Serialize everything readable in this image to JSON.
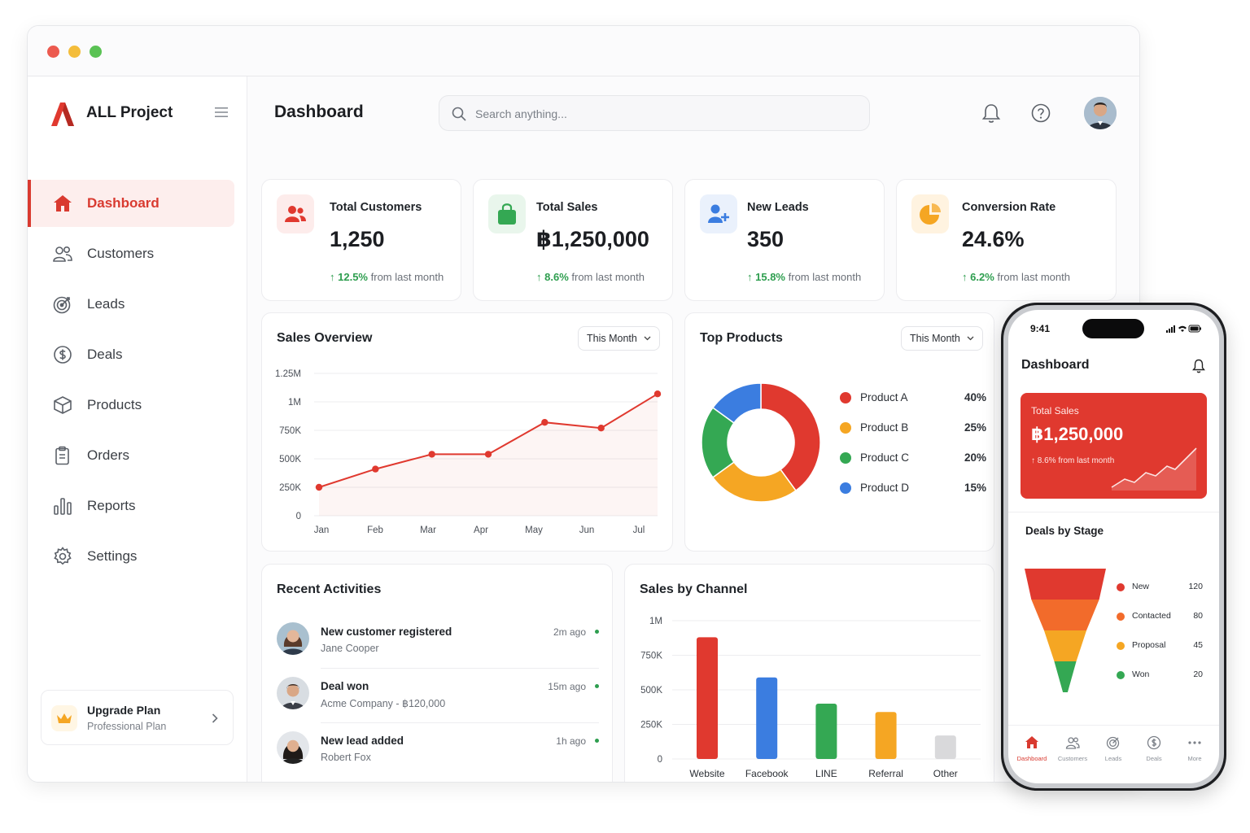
{
  "app": {
    "name": "ALL Project"
  },
  "sidebar": {
    "items": [
      {
        "label": "Dashboard",
        "icon": "home-icon",
        "active": true
      },
      {
        "label": "Customers",
        "icon": "users-icon"
      },
      {
        "label": "Leads",
        "icon": "target-icon"
      },
      {
        "label": "Deals",
        "icon": "dollar-circle-icon"
      },
      {
        "label": "Products",
        "icon": "box-icon"
      },
      {
        "label": "Orders",
        "icon": "clipboard-icon"
      },
      {
        "label": "Reports",
        "icon": "bar-chart-icon"
      },
      {
        "label": "Settings",
        "icon": "gear-icon"
      }
    ],
    "upgrade": {
      "title": "Upgrade Plan",
      "subtitle": "Professional Plan"
    }
  },
  "header": {
    "title": "Dashboard",
    "search_placeholder": "Search anything..."
  },
  "stats": [
    {
      "title": "Total Customers",
      "value": "1,250",
      "change": "12.5%",
      "suffix": "from last month",
      "color": "#e0392f"
    },
    {
      "title": "Total Sales",
      "value": "฿1,250,000",
      "change": "8.6%",
      "suffix": "from last month",
      "color": "#34a853"
    },
    {
      "title": "New Leads",
      "value": "350",
      "change": "15.8%",
      "suffix": "from last month",
      "color": "#3b7de0"
    },
    {
      "title": "Conversion Rate",
      "value": "24.6%",
      "change": "6.2%",
      "suffix": "from last month",
      "color": "#f5a623"
    }
  ],
  "sales_overview": {
    "title": "Sales Overview",
    "period": "This Month"
  },
  "top_products": {
    "title": "Top Products",
    "period": "This Month"
  },
  "recent_activities": {
    "title": "Recent Activities",
    "items": [
      {
        "title": "New customer registered",
        "subtitle": "Jane Cooper",
        "time": "2m ago"
      },
      {
        "title": "Deal won",
        "subtitle": "Acme Company - ฿120,000",
        "time": "15m ago"
      },
      {
        "title": "New lead added",
        "subtitle": "Robert Fox",
        "time": "1h ago"
      }
    ]
  },
  "sales_by_channel": {
    "title": "Sales by Channel"
  },
  "chart_data": [
    {
      "type": "line",
      "title": "Sales Overview",
      "categories": [
        "Jan",
        "Feb",
        "Mar",
        "Apr",
        "May",
        "Jun",
        "Jul"
      ],
      "values": [
        250000,
        410000,
        540000,
        540000,
        820000,
        770000,
        1070000
      ],
      "y_ticks": [
        "0",
        "250K",
        "500K",
        "750K",
        "1M",
        "1.25M"
      ],
      "ylim": [
        0,
        1250000
      ],
      "grid": true,
      "color": "#e0392f"
    },
    {
      "type": "pie",
      "title": "Top Products",
      "categories": [
        "Product A",
        "Product B",
        "Product C",
        "Product D"
      ],
      "values": [
        40,
        25,
        20,
        15
      ],
      "labels": [
        "40%",
        "25%",
        "20%",
        "15%"
      ],
      "colors": [
        "#e0392f",
        "#f5a623",
        "#34a853",
        "#3b7de0"
      ]
    },
    {
      "type": "bar",
      "title": "Sales by Channel",
      "categories": [
        "Website",
        "Facebook",
        "LINE",
        "Referral",
        "Other"
      ],
      "values": [
        880000,
        590000,
        400000,
        340000,
        170000
      ],
      "y_ticks": [
        "0",
        "250K",
        "500K",
        "750K",
        "1M"
      ],
      "ylim": [
        0,
        1000000
      ],
      "grid": true,
      "colors": [
        "#e0392f",
        "#3b7de0",
        "#34a853",
        "#f5a623",
        "#d9d9db"
      ]
    },
    {
      "type": "bar",
      "title": "Deals by Stage",
      "categories": [
        "New",
        "Contacted",
        "Proposal",
        "Won"
      ],
      "values": [
        120,
        80,
        45,
        20
      ],
      "colors": [
        "#e0392f",
        "#f26b2b",
        "#f5a623",
        "#34a853"
      ]
    }
  ],
  "phone": {
    "time": "9:41",
    "title": "Dashboard",
    "sales_card": {
      "label": "Total Sales",
      "value": "฿1,250,000",
      "change": "8.6% from last month"
    },
    "deals_title": "Deals by Stage",
    "stages": [
      {
        "name": "New",
        "value": "120",
        "color": "#e0392f"
      },
      {
        "name": "Contacted",
        "value": "80",
        "color": "#f26b2b"
      },
      {
        "name": "Proposal",
        "value": "45",
        "color": "#f5a623"
      },
      {
        "name": "Won",
        "value": "20",
        "color": "#34a853"
      }
    ],
    "tabs": [
      {
        "label": "Dashboard",
        "icon": "home-icon",
        "active": true
      },
      {
        "label": "Customers",
        "icon": "users-icon"
      },
      {
        "label": "Leads",
        "icon": "target-icon"
      },
      {
        "label": "Deals",
        "icon": "dollar-circle-icon"
      },
      {
        "label": "More",
        "icon": "more-icon"
      }
    ]
  }
}
